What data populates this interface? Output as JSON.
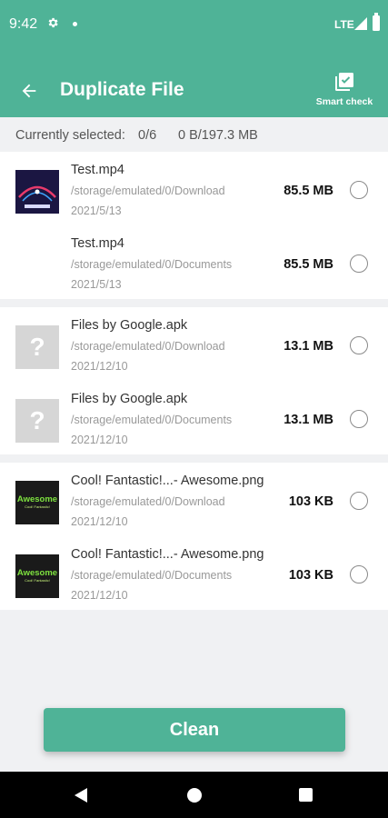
{
  "status_bar": {
    "time": "9:42",
    "network": "LTE",
    "icons": [
      "gear-icon",
      "notification-dot",
      "signal-icon",
      "battery-icon"
    ]
  },
  "header": {
    "back_icon": "arrow-left-icon",
    "title": "Duplicate File",
    "smart_check_label": "Smart check",
    "smart_check_icon": "smart-check-icon"
  },
  "selection": {
    "label": "Currently selected:",
    "count": "0/6",
    "size": "0 B/197.3 MB"
  },
  "groups": [
    {
      "files": [
        {
          "name": "Test.mp4",
          "path": "/storage/emulated/0/Download",
          "date": "2021/5/13",
          "size": "85.5 MB",
          "thumb": "video-thumbnail"
        },
        {
          "name": "Test.mp4",
          "path": "/storage/emulated/0/Documents",
          "date": "2021/5/13",
          "size": "85.5 MB",
          "thumb": "none"
        }
      ]
    },
    {
      "files": [
        {
          "name": "Files by Google.apk",
          "path": "/storage/emulated/0/Download",
          "date": "2021/12/10",
          "size": "13.1 MB",
          "thumb": "unknown-file-icon"
        },
        {
          "name": "Files by Google.apk",
          "path": "/storage/emulated/0/Documents",
          "date": "2021/12/10",
          "size": "13.1 MB",
          "thumb": "unknown-file-icon"
        }
      ]
    },
    {
      "files": [
        {
          "name": "Cool! Fantastic!...- Awesome.png",
          "path": "/storage/emulated/0/Download",
          "date": "2021/12/10",
          "size": "103 KB",
          "thumb": "awesome-image-thumbnail"
        },
        {
          "name": "Cool! Fantastic!...- Awesome.png",
          "path": "/storage/emulated/0/Documents",
          "date": "2021/12/10",
          "size": "103 KB",
          "thumb": "awesome-image-thumbnail"
        }
      ]
    }
  ],
  "thumb_text": {
    "unknown": "?",
    "awesome_main": "Awesome",
    "awesome_sub": "Cool! Fantastic!"
  },
  "clean_button": "Clean",
  "nav_bar": {
    "icons": [
      "back-triangle-icon",
      "home-circle-icon",
      "recents-square-icon"
    ]
  },
  "colors": {
    "accent": "#4fb397",
    "background": "#f0f1f3",
    "navbar": "#000000"
  }
}
